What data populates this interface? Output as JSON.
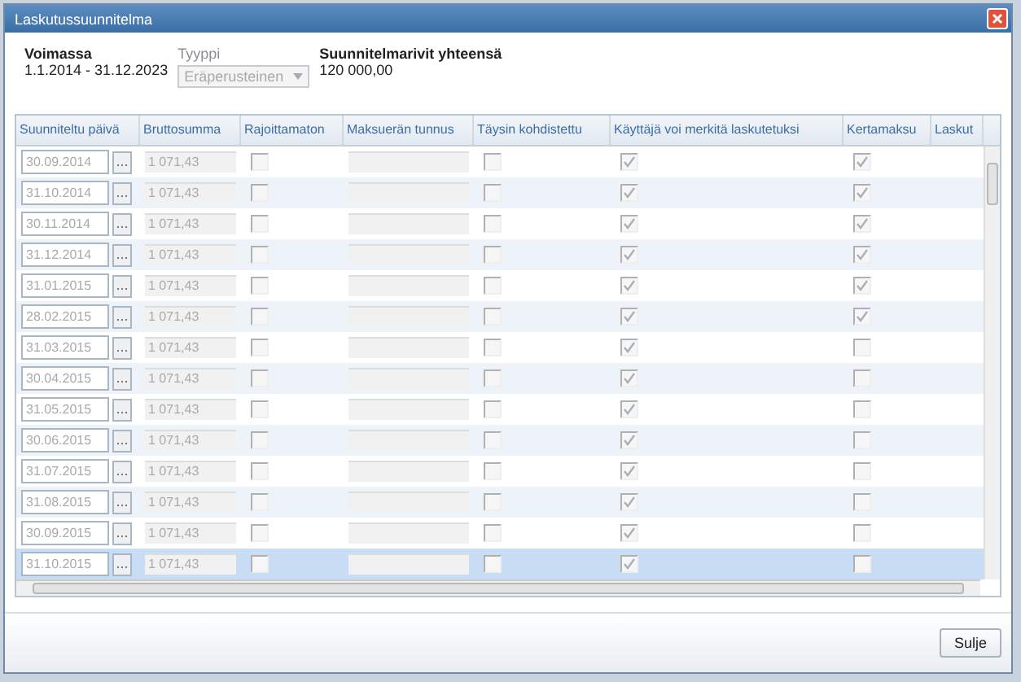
{
  "window": {
    "title": "Laskutussuunnitelma"
  },
  "summary": {
    "validity_label": "Voimassa",
    "validity_value": "1.1.2014 - 31.12.2023",
    "type_label": "Tyyppi",
    "type_value": "Eräperusteinen",
    "total_label": "Suunnitelmarivit yhteensä",
    "total_value": "120 000,00"
  },
  "table": {
    "columns": [
      "Suunniteltu päivä",
      "Bruttosumma",
      "Rajoittamaton",
      "Maksuerän tunnus",
      "Täysin kohdistettu",
      "Käyttäjä voi merkitä laskutetuksi",
      "Kertamaksu",
      "Laskut"
    ],
    "date_button": "...",
    "rows": [
      {
        "date": "30.09.2014",
        "amount": "1 071,43",
        "unrestricted": false,
        "fully_allocated": false,
        "user_can_mark": true,
        "one_time": true,
        "selected": false
      },
      {
        "date": "31.10.2014",
        "amount": "1 071,43",
        "unrestricted": false,
        "fully_allocated": false,
        "user_can_mark": true,
        "one_time": true,
        "selected": false
      },
      {
        "date": "30.11.2014",
        "amount": "1 071,43",
        "unrestricted": false,
        "fully_allocated": false,
        "user_can_mark": true,
        "one_time": true,
        "selected": false
      },
      {
        "date": "31.12.2014",
        "amount": "1 071,43",
        "unrestricted": false,
        "fully_allocated": false,
        "user_can_mark": true,
        "one_time": true,
        "selected": false
      },
      {
        "date": "31.01.2015",
        "amount": "1 071,43",
        "unrestricted": false,
        "fully_allocated": false,
        "user_can_mark": true,
        "one_time": true,
        "selected": false
      },
      {
        "date": "28.02.2015",
        "amount": "1 071,43",
        "unrestricted": false,
        "fully_allocated": false,
        "user_can_mark": true,
        "one_time": true,
        "selected": false
      },
      {
        "date": "31.03.2015",
        "amount": "1 071,43",
        "unrestricted": false,
        "fully_allocated": false,
        "user_can_mark": true,
        "one_time": false,
        "selected": false
      },
      {
        "date": "30.04.2015",
        "amount": "1 071,43",
        "unrestricted": false,
        "fully_allocated": false,
        "user_can_mark": true,
        "one_time": false,
        "selected": false
      },
      {
        "date": "31.05.2015",
        "amount": "1 071,43",
        "unrestricted": false,
        "fully_allocated": false,
        "user_can_mark": true,
        "one_time": false,
        "selected": false
      },
      {
        "date": "30.06.2015",
        "amount": "1 071,43",
        "unrestricted": false,
        "fully_allocated": false,
        "user_can_mark": true,
        "one_time": false,
        "selected": false
      },
      {
        "date": "31.07.2015",
        "amount": "1 071,43",
        "unrestricted": false,
        "fully_allocated": false,
        "user_can_mark": true,
        "one_time": false,
        "selected": false
      },
      {
        "date": "31.08.2015",
        "amount": "1 071,43",
        "unrestricted": false,
        "fully_allocated": false,
        "user_can_mark": true,
        "one_time": false,
        "selected": false
      },
      {
        "date": "30.09.2015",
        "amount": "1 071,43",
        "unrestricted": false,
        "fully_allocated": false,
        "user_can_mark": true,
        "one_time": false,
        "selected": false
      },
      {
        "date": "31.10.2015",
        "amount": "1 071,43",
        "unrestricted": false,
        "fully_allocated": false,
        "user_can_mark": true,
        "one_time": false,
        "selected": true
      }
    ]
  },
  "buttons": [
    "Sulje"
  ]
}
